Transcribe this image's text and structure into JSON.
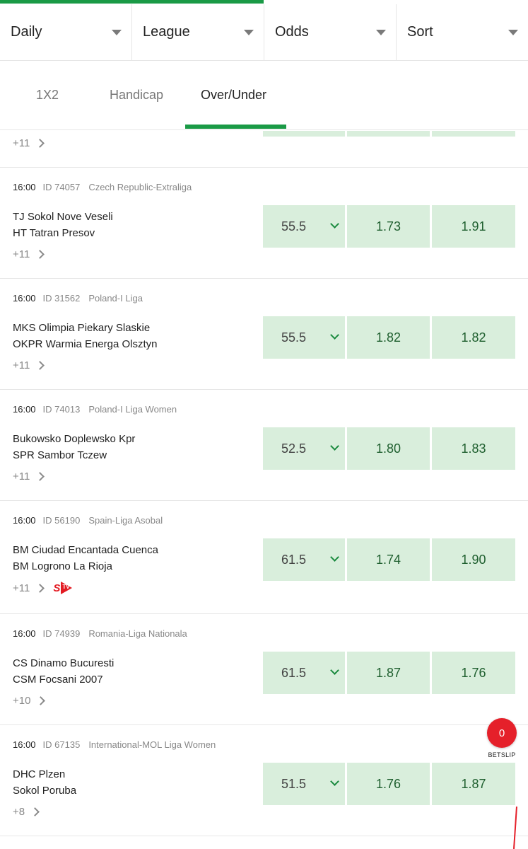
{
  "filters": [
    {
      "label": "Daily"
    },
    {
      "label": "League"
    },
    {
      "label": "Odds"
    },
    {
      "label": "Sort"
    }
  ],
  "tabs": [
    {
      "label": "1X2",
      "active": false
    },
    {
      "label": "Handicap",
      "active": false
    },
    {
      "label": "Over/Under",
      "active": true
    }
  ],
  "partial_row": {
    "more": "+11"
  },
  "events": [
    {
      "time": "16:00",
      "id": "ID 74057",
      "league": "Czech Republic-Extraliga",
      "home": "TJ Sokol Nove Veseli",
      "away": "HT Tatran Presov",
      "line": "55.5",
      "over": "1.73",
      "under": "1.91",
      "more": "+11",
      "stv": false
    },
    {
      "time": "16:00",
      "id": "ID 31562",
      "league": "Poland-I Liga",
      "home": "MKS Olimpia Piekary Slaskie",
      "away": "OKPR Warmia Energa Olsztyn",
      "line": "55.5",
      "over": "1.82",
      "under": "1.82",
      "more": "+11",
      "stv": false
    },
    {
      "time": "16:00",
      "id": "ID 74013",
      "league": "Poland-I Liga Women",
      "home": "Bukowsko Doplewsko Kpr",
      "away": "SPR Sambor Tczew",
      "line": "52.5",
      "over": "1.80",
      "under": "1.83",
      "more": "+11",
      "stv": false
    },
    {
      "time": "16:00",
      "id": "ID 56190",
      "league": "Spain-Liga Asobal",
      "home": "BM Ciudad Encantada Cuenca",
      "away": "BM Logrono La Rioja",
      "line": "61.5",
      "over": "1.74",
      "under": "1.90",
      "more": "+11",
      "stv": true
    },
    {
      "time": "16:00",
      "id": "ID 74939",
      "league": "Romania-Liga Nationala",
      "home": "CS Dinamo Bucuresti",
      "away": "CSM Focsani 2007",
      "line": "61.5",
      "over": "1.87",
      "under": "1.76",
      "more": "+10",
      "stv": false
    },
    {
      "time": "16:00",
      "id": "ID 67135",
      "league": "International-MOL Liga Women",
      "home": "DHC Plzen",
      "away": "Sokol Poruba",
      "line": "51.5",
      "over": "1.76",
      "under": "1.87",
      "more": "+8",
      "stv": false
    }
  ],
  "stv_badge": {
    "letter": "S",
    "text": "TV"
  },
  "betslip": {
    "count": "0",
    "label": "BETSLIP"
  },
  "colors": {
    "accent": "#1a9a46",
    "odds_bg": "#d9eedc",
    "odds_text": "#1f5f2f",
    "betslip": "#e5202a"
  }
}
